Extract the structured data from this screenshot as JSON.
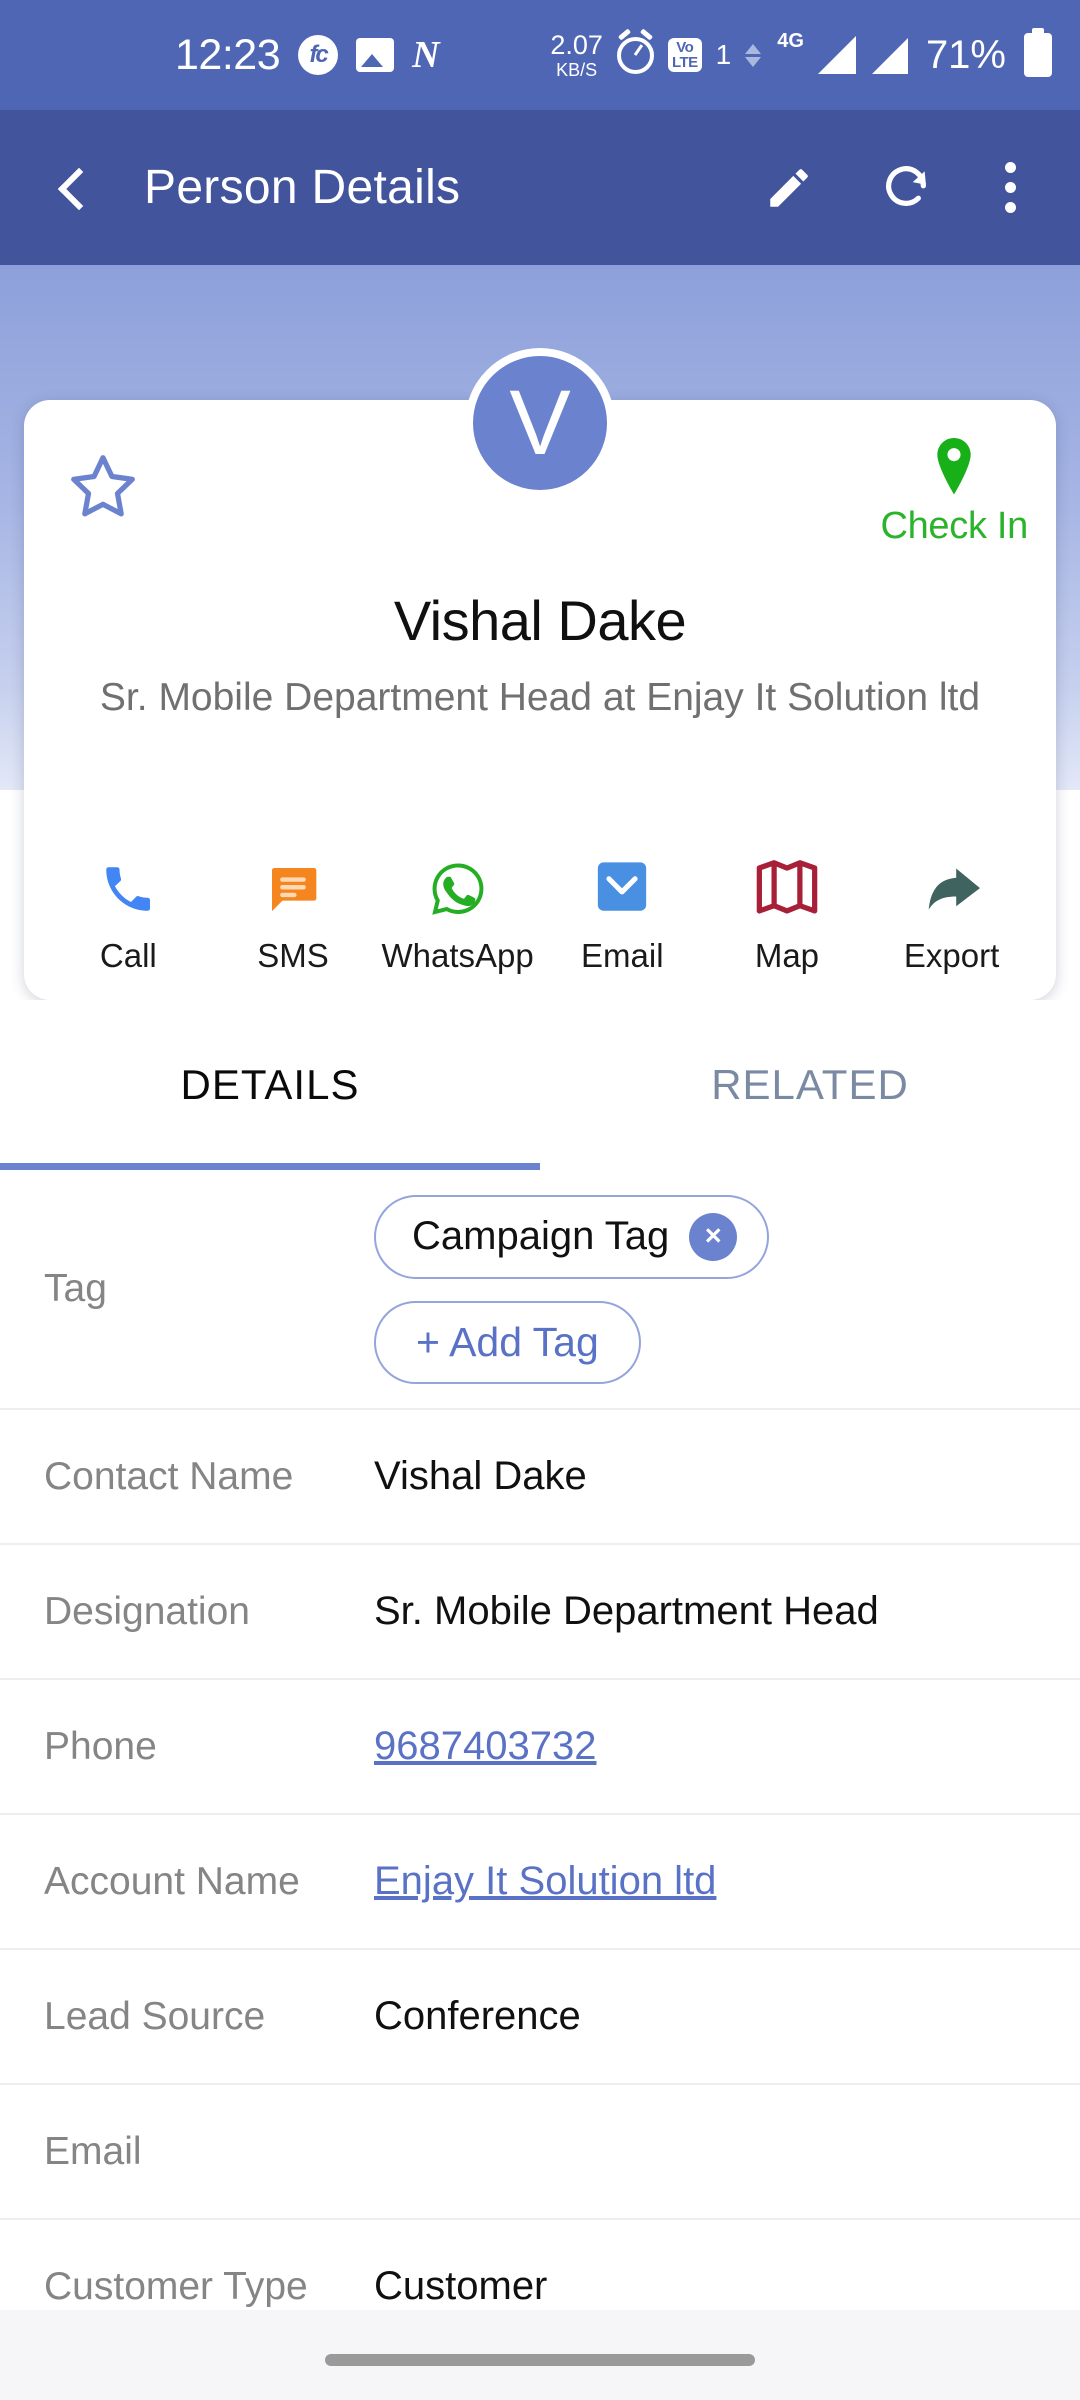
{
  "status_bar": {
    "time": "12:23",
    "icons": [
      "fc-app-icon",
      "gallery-icon",
      "n-app-icon"
    ],
    "data_rate_value": "2.07",
    "data_rate_unit": "KB/S",
    "alarm": "alarm-icon",
    "volte_line1": "Vo",
    "volte_line2": "LTE",
    "sim_number": "1",
    "network": "4G",
    "battery_percent": "71%"
  },
  "app_bar": {
    "title": "Person Details",
    "back": "back-arrow",
    "edit": "edit-pencil",
    "refresh": "refresh",
    "overflow": "more-options"
  },
  "profile": {
    "avatar_initial": "V",
    "avatar_color": "#6b82cf",
    "name": "Vishal Dake",
    "subtitle": "Sr. Mobile Department Head at Enjay It Solution ltd",
    "favorite_icon": "star-outline",
    "check_in_label": "Check In",
    "check_in_color": "#2cb32c"
  },
  "actions": [
    {
      "label": "Call",
      "icon": "phone-icon",
      "color": "#4285f4"
    },
    {
      "label": "SMS",
      "icon": "message-icon",
      "color": "#f4851f"
    },
    {
      "label": "WhatsApp",
      "icon": "whatsapp-icon",
      "color": "#25ae24"
    },
    {
      "label": "Email",
      "icon": "email-icon",
      "color": "#4a90e2"
    },
    {
      "label": "Map",
      "icon": "map-icon",
      "color": "#a81f38"
    },
    {
      "label": "Export",
      "icon": "share-arrow-icon",
      "color": "#3f6460"
    }
  ],
  "tabs": [
    {
      "label": "DETAILS",
      "active": true
    },
    {
      "label": "RELATED",
      "active": false
    }
  ],
  "details": {
    "tag_label": "Tag",
    "tag_chip": "Campaign Tag",
    "tag_chip_remove": "×",
    "add_tag_label": "+ Add Tag",
    "rows": [
      {
        "label": "Contact Name",
        "value": "Vishal Dake",
        "link": false
      },
      {
        "label": "Designation",
        "value": "Sr. Mobile Department Head",
        "link": false
      },
      {
        "label": "Phone",
        "value": "9687403732",
        "link": true
      },
      {
        "label": "Account Name",
        "value": "Enjay It Solution ltd",
        "link": true
      },
      {
        "label": "Lead Source",
        "value": "Conference",
        "link": false
      },
      {
        "label": "Email",
        "value": "",
        "link": false
      },
      {
        "label": "Customer Type",
        "value": "Customer",
        "link": false
      }
    ]
  }
}
